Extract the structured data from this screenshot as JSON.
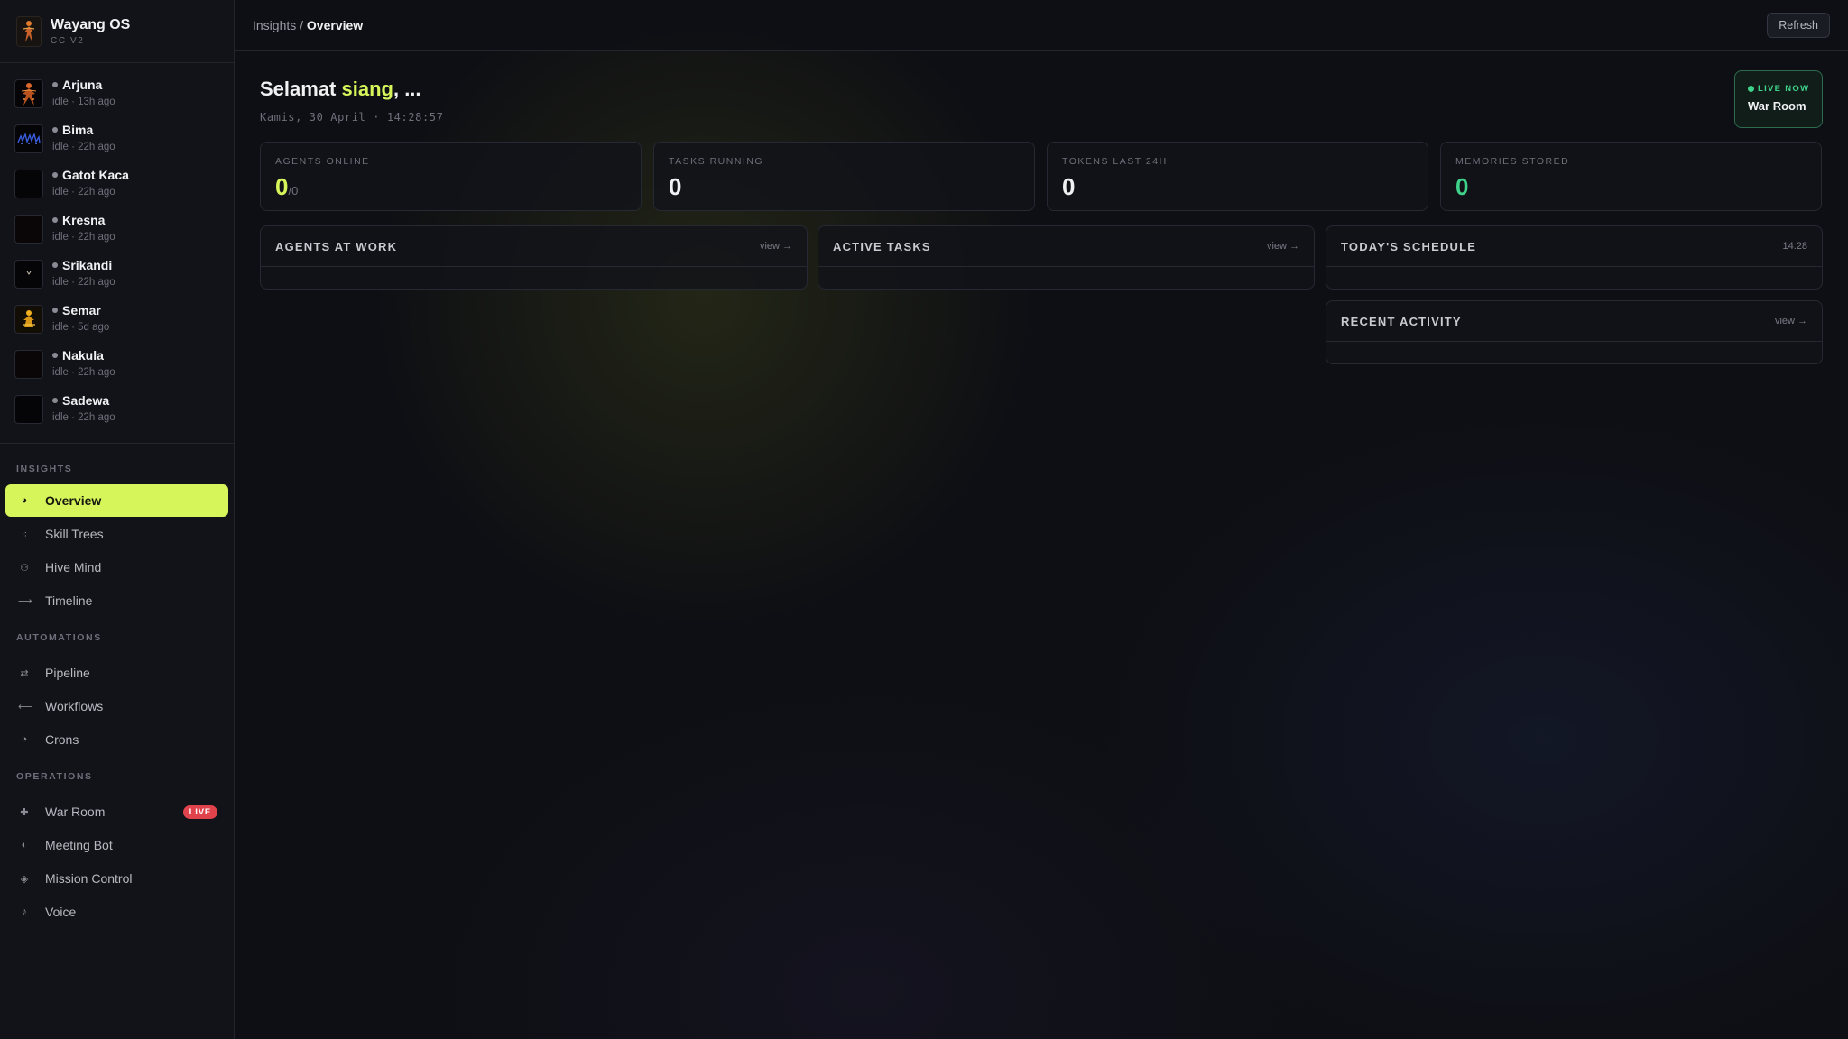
{
  "brand": {
    "title": "Wayang OS",
    "subtitle": "CC V2"
  },
  "agents": [
    {
      "name": "Arjuna",
      "status": "idle · 13h ago",
      "avatar": "wayang-figure-orange"
    },
    {
      "name": "Bima",
      "status": "idle · 22h ago",
      "avatar": "wayang-figure-blue"
    },
    {
      "name": "Gatot Kaca",
      "status": "idle · 22h ago",
      "avatar": "blank"
    },
    {
      "name": "Kresna",
      "status": "idle · 22h ago",
      "avatar": "blank"
    },
    {
      "name": "Srikandi",
      "status": "idle · 22h ago",
      "avatar": "wayang-figure-small"
    },
    {
      "name": "Semar",
      "status": "idle · 5d ago",
      "avatar": "wayang-figure-gold"
    },
    {
      "name": "Nakula",
      "status": "idle · 22h ago",
      "avatar": "blank"
    },
    {
      "name": "Sadewa",
      "status": "idle · 22h ago",
      "avatar": "blank"
    }
  ],
  "nav": {
    "insights_label": "INSIGHTS",
    "insights": [
      {
        "label": "Overview",
        "icon": "overview-icon",
        "active": true
      },
      {
        "label": "Skill Trees",
        "icon": "skill-trees-icon"
      },
      {
        "label": "Hive Mind",
        "icon": "hive-mind-icon"
      },
      {
        "label": "Timeline",
        "icon": "timeline-icon"
      }
    ],
    "automations_label": "AUTOMATIONS",
    "automations": [
      {
        "label": "Pipeline",
        "icon": "pipeline-icon"
      },
      {
        "label": "Workflows",
        "icon": "workflows-icon"
      },
      {
        "label": "Crons",
        "icon": "crons-icon"
      }
    ],
    "operations_label": "OPERATIONS",
    "operations": [
      {
        "label": "War Room",
        "icon": "war-room-icon",
        "badge": "LIVE"
      },
      {
        "label": "Meeting Bot",
        "icon": "meeting-bot-icon"
      },
      {
        "label": "Mission Control",
        "icon": "mission-control-icon"
      },
      {
        "label": "Voice",
        "icon": "voice-icon"
      }
    ]
  },
  "topbar": {
    "breadcrumb_parent": "Insights",
    "breadcrumb_sep": " / ",
    "breadcrumb_current": "Overview",
    "refresh_label": "Refresh"
  },
  "greeting": {
    "prefix": "Selamat ",
    "accent": "siang",
    "suffix": ", ...",
    "date": "Kamis, 30 April · 14:28:57"
  },
  "live_card": {
    "label": "LIVE NOW",
    "name": "War Room"
  },
  "stats": {
    "agents_online": {
      "label": "AGENTS ONLINE",
      "value": "0",
      "total": "/0"
    },
    "tasks_running": {
      "label": "TASKS RUNNING",
      "value": "0"
    },
    "tokens_24h": {
      "label": "TOKENS LAST 24H",
      "value": "0"
    },
    "memories": {
      "label": "MEMORIES STORED",
      "value": "0"
    }
  },
  "panels": {
    "agents_at_work": {
      "title": "AGENTS AT WORK",
      "link": "view →"
    },
    "active_tasks": {
      "title": "ACTIVE TASKS",
      "link": "view →"
    },
    "schedule": {
      "title": "TODAY'S SCHEDULE",
      "time": "14:28"
    },
    "recent_activity": {
      "title": "RECENT ACTIVITY",
      "link": "view →"
    }
  },
  "colors": {
    "accent_lime": "#d6f55a",
    "live_green": "#3fd28a",
    "live_badge_red": "#e0434c"
  }
}
